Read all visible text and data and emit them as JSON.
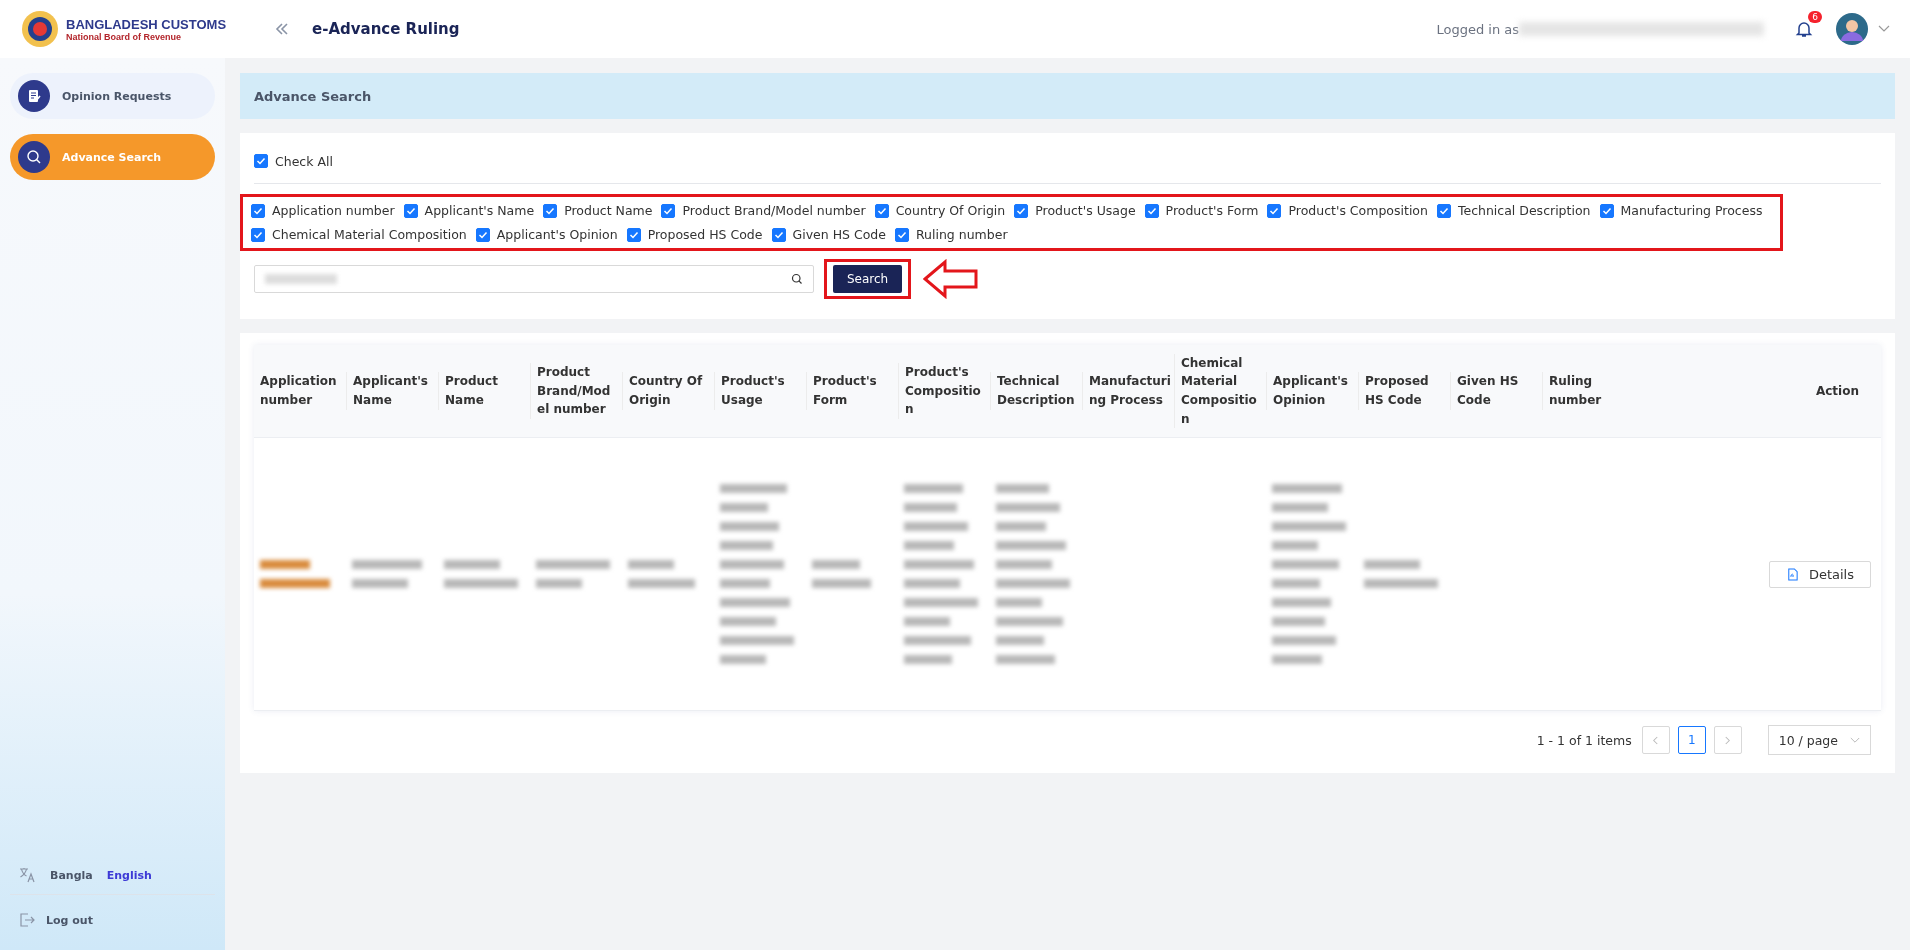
{
  "header": {
    "logo_title": "BANGLADESH CUSTOMS",
    "logo_subtitle": "National Board of Revenue",
    "app_title": "e-Advance Ruling",
    "logged_in_label": "Logged in as",
    "notification_count": "6"
  },
  "sidebar": {
    "items": [
      {
        "label": "Opinion Requests",
        "selected": false,
        "kind": "document"
      },
      {
        "label": "Advance Search",
        "selected": true,
        "kind": "search"
      }
    ],
    "languages": [
      {
        "label": "Bangla",
        "selected": false
      },
      {
        "label": "English",
        "selected": true
      }
    ],
    "logout": "Log out"
  },
  "page_title": "Advance Search",
  "check_all": {
    "label": "Check All",
    "checked": true
  },
  "filters": [
    {
      "label": "Application number",
      "checked": true
    },
    {
      "label": "Applicant's Name",
      "checked": true
    },
    {
      "label": "Product Name",
      "checked": true
    },
    {
      "label": "Product Brand/Model number",
      "checked": true
    },
    {
      "label": "Country Of Origin",
      "checked": true
    },
    {
      "label": "Product's Usage",
      "checked": true
    },
    {
      "label": "Product's Form",
      "checked": true
    },
    {
      "label": "Product's Composition",
      "checked": true
    },
    {
      "label": "Technical Description",
      "checked": true
    },
    {
      "label": "Manufacturing Process",
      "checked": true
    },
    {
      "label": "Chemical Material Composition",
      "checked": true
    },
    {
      "label": "Applicant's Opinion",
      "checked": true
    },
    {
      "label": "Proposed HS Code",
      "checked": true
    },
    {
      "label": "Given HS Code",
      "checked": true
    },
    {
      "label": "Ruling number",
      "checked": true
    }
  ],
  "search": {
    "button": "Search"
  },
  "table": {
    "columns": [
      "Application number",
      "Applicant's Name",
      "Product Name",
      "Product Brand/Mod el number",
      "Country Of Origin",
      "Product's Usage",
      "Product's Form",
      "Product's Compositio n",
      "Technical Description",
      "Manufacturi ng Process",
      "Chemical Material Compositio n",
      "Applicant's Opinion",
      "Proposed HS Code",
      "Given HS Code",
      "Ruling number"
    ],
    "action_column": "Action",
    "rows": [
      {
        "cells": [
          {
            "kind": "highlighted"
          },
          {
            "kind": "short"
          },
          {
            "kind": "short"
          },
          {
            "kind": "short"
          },
          {
            "kind": "short"
          },
          {
            "kind": "tall"
          },
          {
            "kind": "short"
          },
          {
            "kind": "tall"
          },
          {
            "kind": "tall"
          },
          {
            "kind": "empty"
          },
          {
            "kind": "empty"
          },
          {
            "kind": "tall"
          },
          {
            "kind": "short"
          },
          {
            "kind": "empty"
          },
          {
            "kind": "empty"
          }
        ],
        "action": "Details"
      }
    ]
  },
  "pagination": {
    "summary": "1 - 1 of 1 items",
    "pages": [
      {
        "label": "1",
        "selected": true
      }
    ],
    "page_size": "10 / page"
  }
}
